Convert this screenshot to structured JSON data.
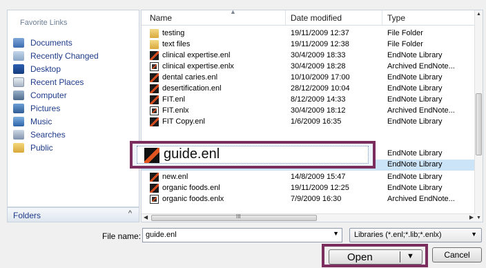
{
  "nav": {
    "header": "Favorite Links",
    "items": [
      {
        "label": "Documents",
        "icon": "documents-icon"
      },
      {
        "label": "Recently Changed",
        "icon": "recently-changed-icon"
      },
      {
        "label": "Desktop",
        "icon": "desktop-icon"
      },
      {
        "label": "Recent Places",
        "icon": "recent-places-icon"
      },
      {
        "label": "Computer",
        "icon": "computer-icon"
      },
      {
        "label": "Pictures",
        "icon": "pictures-icon"
      },
      {
        "label": "Music",
        "icon": "music-icon"
      },
      {
        "label": "Searches",
        "icon": "searches-icon"
      },
      {
        "label": "Public",
        "icon": "public-icon"
      }
    ],
    "folders_label": "Folders",
    "folders_chevron": "^"
  },
  "list": {
    "columns": {
      "name": "Name",
      "date": "Date modified",
      "type": "Type"
    },
    "rows": [
      {
        "name": "testing",
        "date": "19/11/2009 12:37",
        "type": "File Folder",
        "icon": "folder-icon"
      },
      {
        "name": "text files",
        "date": "19/11/2009 12:38",
        "type": "File Folder",
        "icon": "folder-icon"
      },
      {
        "name": "clinical expertise.enl",
        "date": "30/4/2009 18:33",
        "type": "EndNote Library",
        "icon": "endnote-library-icon"
      },
      {
        "name": "clinical expertise.enlx",
        "date": "30/4/2009 18:28",
        "type": "Archived EndNote...",
        "icon": "endnote-archive-icon"
      },
      {
        "name": "dental caries.enl",
        "date": "10/10/2009 17:00",
        "type": "EndNote Library",
        "icon": "endnote-library-icon"
      },
      {
        "name": "desertification.enl",
        "date": "28/12/2009 10:04",
        "type": "EndNote Library",
        "icon": "endnote-library-icon"
      },
      {
        "name": "FIT.enl",
        "date": "8/12/2009 14:33",
        "type": "EndNote Library",
        "icon": "endnote-library-icon"
      },
      {
        "name": "FIT.enlx",
        "date": "30/4/2009 18:12",
        "type": "Archived EndNote...",
        "icon": "endnote-archive-icon"
      },
      {
        "name": "FIT Copy.enl",
        "date": "1/6/2009 16:35",
        "type": "EndNote Library",
        "icon": "endnote-library-icon"
      },
      {
        "name": "",
        "date": "",
        "type": "EndNote Library",
        "icon": "endnote-library-icon"
      },
      {
        "name": "",
        "date": "",
        "type": "EndNote Library",
        "icon": "endnote-library-icon"
      },
      {
        "name": "new.enl",
        "date": "14/8/2009 15:47",
        "type": "EndNote Library",
        "icon": "endnote-library-icon"
      },
      {
        "name": "organic foods.enl",
        "date": "19/11/2009 12:25",
        "type": "EndNote Library",
        "icon": "endnote-library-icon"
      },
      {
        "name": "organic foods.enlx",
        "date": "7/9/2009 16:30",
        "type": "Archived EndNote...",
        "icon": "endnote-archive-icon"
      }
    ],
    "highlighted_file": "guide.enl",
    "hscroll_grip": "III"
  },
  "footer": {
    "filename_label": "File name:",
    "filename_value": "guide.enl",
    "filter_value": "Libraries (*.enl;*.lib;*.enlx)",
    "open_label": "Open",
    "cancel_label": "Cancel"
  },
  "colors": {
    "highlight_border": "#7b2d5e",
    "link": "#1e3a8a",
    "selection": "#cce4f7"
  }
}
